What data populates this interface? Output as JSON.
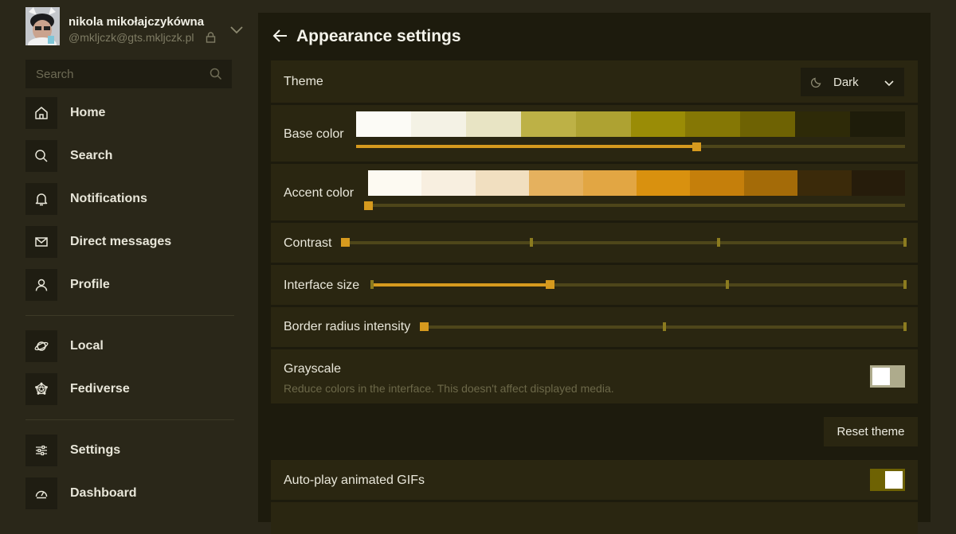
{
  "account": {
    "display_name": "nikola mikołajczykówna",
    "handle": "@mkljczk@gts.mkljczk.pl",
    "icons": {
      "lock": "lock-icon",
      "chevron": "chevron-down-icon"
    }
  },
  "search": {
    "placeholder": "Search"
  },
  "nav": {
    "primary": [
      {
        "label": "Home",
        "icon": "home-icon"
      },
      {
        "label": "Search",
        "icon": "search-icon"
      },
      {
        "label": "Notifications",
        "icon": "bell-icon"
      },
      {
        "label": "Direct messages",
        "icon": "mail-icon"
      },
      {
        "label": "Profile",
        "icon": "user-icon"
      }
    ],
    "timelines": [
      {
        "label": "Local",
        "icon": "planet-icon"
      },
      {
        "label": "Fediverse",
        "icon": "fediverse-icon"
      }
    ],
    "admin": [
      {
        "label": "Settings",
        "icon": "sliders-icon"
      },
      {
        "label": "Dashboard",
        "icon": "gauge-icon"
      }
    ]
  },
  "page": {
    "title": "Appearance settings",
    "back_icon": "arrow-left-icon"
  },
  "settings": {
    "theme": {
      "label": "Theme",
      "value": "Dark",
      "icon": "moon-icon"
    },
    "base_color": {
      "label": "Base color",
      "swatches": [
        "#fcfbf6",
        "#f4f2e5",
        "#e8e4c4",
        "#bdb146",
        "#aea232",
        "#9a8c06",
        "#857705",
        "#6e6203",
        "#2e2a08",
        "#1e1c0a"
      ],
      "value": 0.62
    },
    "accent_color": {
      "label": "Accent color",
      "swatches": [
        "#fdfaf2",
        "#f8efe0",
        "#f1dfc0",
        "#e5b15e",
        "#e2a643",
        "#d9910f",
        "#c57f0b",
        "#a46b08",
        "#3b2a0a",
        "#261c0b"
      ],
      "value": 0
    },
    "contrast": {
      "label": "Contrast",
      "steps": 4,
      "value": 0
    },
    "interface_size": {
      "label": "Interface size",
      "steps": 4,
      "value": 1
    },
    "border_radius": {
      "label": "Border radius intensity",
      "steps": 3,
      "value": 0
    },
    "grayscale": {
      "label": "Grayscale",
      "description": "Reduce colors in the interface. This doesn't affect displayed media.",
      "enabled": false
    },
    "reset_label": "Reset theme",
    "autoplay_gifs": {
      "label": "Auto-play animated GIFs",
      "enabled": true
    }
  },
  "colors": {
    "sidebar_bg": "#2a2719",
    "main_bg": "#1d1b0d",
    "row_bg": "#2a2611",
    "accent": "#d69a1e"
  }
}
